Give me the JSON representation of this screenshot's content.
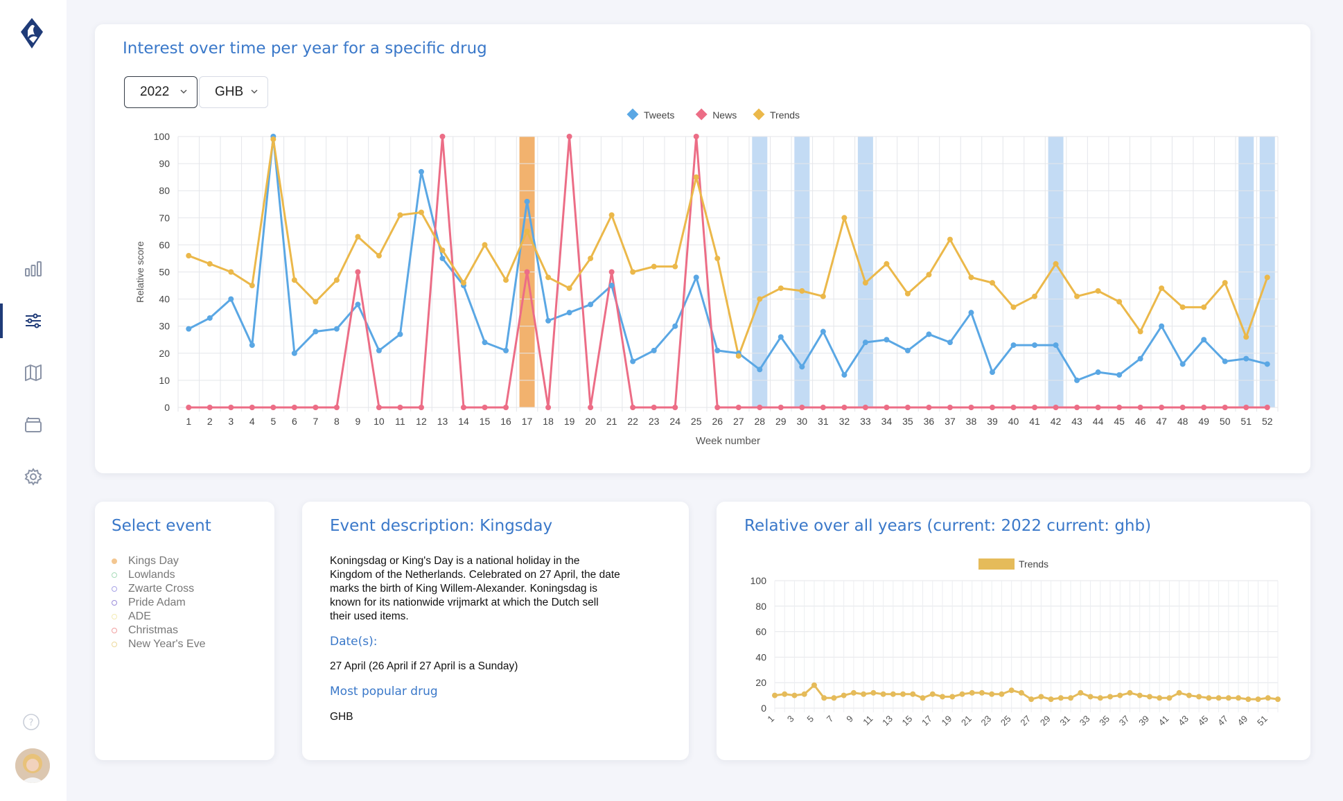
{
  "sidebar": {
    "items": [
      {
        "icon": "bar-chart-icon",
        "active": false
      },
      {
        "icon": "sliders-icon",
        "active": true
      },
      {
        "icon": "map-icon",
        "active": false
      },
      {
        "icon": "archive-icon",
        "active": false
      },
      {
        "icon": "gear-icon",
        "active": false
      }
    ],
    "help_icon": "question-icon"
  },
  "main": {
    "title": "Interest over time per year for a specific drug",
    "year_value": "2022",
    "drug_value": "GHB"
  },
  "chart_data": [
    {
      "type": "line",
      "ylabel": "Relative score",
      "xlabel": "Week number",
      "ylim": [
        0,
        100
      ],
      "yticks": [
        0,
        10,
        20,
        30,
        40,
        50,
        60,
        70,
        80,
        90,
        100
      ],
      "x": [
        1,
        2,
        3,
        4,
        5,
        6,
        7,
        8,
        9,
        10,
        11,
        12,
        13,
        14,
        15,
        16,
        17,
        18,
        19,
        20,
        21,
        22,
        23,
        24,
        25,
        26,
        27,
        28,
        29,
        30,
        31,
        32,
        33,
        34,
        35,
        36,
        37,
        38,
        39,
        40,
        41,
        42,
        43,
        44,
        45,
        46,
        47,
        48,
        49,
        50,
        51,
        52
      ],
      "legend_position": "top",
      "series": [
        {
          "name": "Tweets",
          "color": "#5aa7e4",
          "values": [
            29,
            33,
            40,
            23,
            100,
            20,
            28,
            29,
            38,
            21,
            27,
            87,
            55,
            45,
            24,
            21,
            76,
            32,
            35,
            38,
            45,
            17,
            21,
            30,
            48,
            21,
            20,
            14,
            26,
            15,
            28,
            12,
            24,
            25,
            21,
            27,
            24,
            35,
            13,
            23,
            23,
            23,
            10,
            13,
            12,
            18,
            30,
            16,
            25,
            17,
            18,
            16
          ]
        },
        {
          "name": "News",
          "color": "#ec6d86",
          "values": [
            0,
            0,
            0,
            0,
            0,
            0,
            0,
            0,
            50,
            0,
            0,
            0,
            100,
            0,
            0,
            0,
            50,
            0,
            100,
            0,
            50,
            0,
            0,
            0,
            100,
            0,
            0,
            0,
            0,
            0,
            0,
            0,
            0,
            0,
            0,
            0,
            0,
            0,
            0,
            0,
            0,
            0,
            0,
            0,
            0,
            0,
            0,
            0,
            0,
            0,
            0,
            0
          ]
        },
        {
          "name": "Trends",
          "color": "#ebb84a",
          "values": [
            56,
            53,
            50,
            45,
            99,
            47,
            39,
            47,
            63,
            56,
            71,
            72,
            58,
            46,
            60,
            47,
            65,
            48,
            44,
            55,
            71,
            50,
            52,
            52,
            85,
            55,
            19,
            40,
            44,
            43,
            41,
            70,
            46,
            53,
            42,
            49,
            62,
            48,
            46,
            37,
            41,
            53,
            41,
            43,
            39,
            28,
            44,
            37,
            37,
            46,
            26,
            48
          ]
        }
      ],
      "highlight_bands": [
        {
          "week": 17,
          "color": "#f2b26e"
        },
        {
          "week": 28,
          "color": "#c3dbf4"
        },
        {
          "week": 30,
          "color": "#c3dbf4"
        },
        {
          "week": 33,
          "color": "#c3dbf4"
        },
        {
          "week": 42,
          "color": "#c3dbf4"
        },
        {
          "week": 51,
          "color": "#c3dbf4"
        },
        {
          "week": 52,
          "color": "#c3dbf4"
        }
      ]
    },
    {
      "type": "line",
      "ylim": [
        0,
        100
      ],
      "yticks": [
        0,
        20,
        40,
        60,
        80,
        100
      ],
      "x": [
        1,
        2,
        3,
        4,
        5,
        6,
        7,
        8,
        9,
        10,
        11,
        12,
        13,
        14,
        15,
        16,
        17,
        18,
        19,
        20,
        21,
        22,
        23,
        24,
        25,
        26,
        27,
        28,
        29,
        30,
        31,
        32,
        33,
        34,
        35,
        36,
        37,
        38,
        39,
        40,
        41,
        42,
        43,
        44,
        45,
        46,
        47,
        48,
        49,
        50,
        51,
        52
      ],
      "xtick_labels": [
        1,
        3,
        5,
        7,
        9,
        11,
        13,
        15,
        17,
        19,
        21,
        23,
        25,
        27,
        29,
        31,
        33,
        35,
        37,
        39,
        41,
        43,
        45,
        47,
        49,
        51
      ],
      "legend_position": "top",
      "series": [
        {
          "name": "Trends",
          "color": "#e5bb5a",
          "values": [
            10,
            11,
            10,
            11,
            18,
            8,
            8,
            10,
            12,
            11,
            12,
            11,
            11,
            11,
            11,
            8,
            11,
            9,
            9,
            11,
            12,
            12,
            11,
            11,
            14,
            12,
            7,
            9,
            7,
            8,
            8,
            12,
            9,
            8,
            9,
            10,
            12,
            10,
            9,
            8,
            8,
            12,
            10,
            9,
            8,
            8,
            8,
            8,
            7,
            7,
            8,
            7,
            9
          ]
        }
      ]
    }
  ],
  "events": {
    "title": "Select event",
    "items": [
      {
        "label": "Kings Day",
        "color": "#f3c690",
        "filled": true
      },
      {
        "label": "Lowlands",
        "color": "#a8dbb8",
        "filled": false
      },
      {
        "label": "Zwarte Cross",
        "color": "#a8a3e6",
        "filled": false
      },
      {
        "label": "Pride Adam",
        "color": "#9a8bd9",
        "filled": false
      },
      {
        "label": "ADE",
        "color": "#f4ebb2",
        "filled": false
      },
      {
        "label": "Christmas",
        "color": "#f1a0a0",
        "filled": false
      },
      {
        "label": "New Year's Eve",
        "color": "#ecd89a",
        "filled": false
      }
    ]
  },
  "description": {
    "title": "Event description: Kingsday",
    "text": "Koningsdag or King's Day is a national holiday in the Kingdom of the Netherlands. Celebrated on 27 April, the date marks the birth of King Willem-Alexander. Koningsdag is known for its nationwide vrijmarkt at which the Dutch sell their used items.",
    "dates_label": "Date(s):",
    "dates_value": "27 April (26 April if 27 April is a Sunday)",
    "popular_label": "Most popular drug",
    "popular_value": "GHB"
  },
  "relative": {
    "title": "Relative over all years (current: 2022 current: ghb)"
  }
}
